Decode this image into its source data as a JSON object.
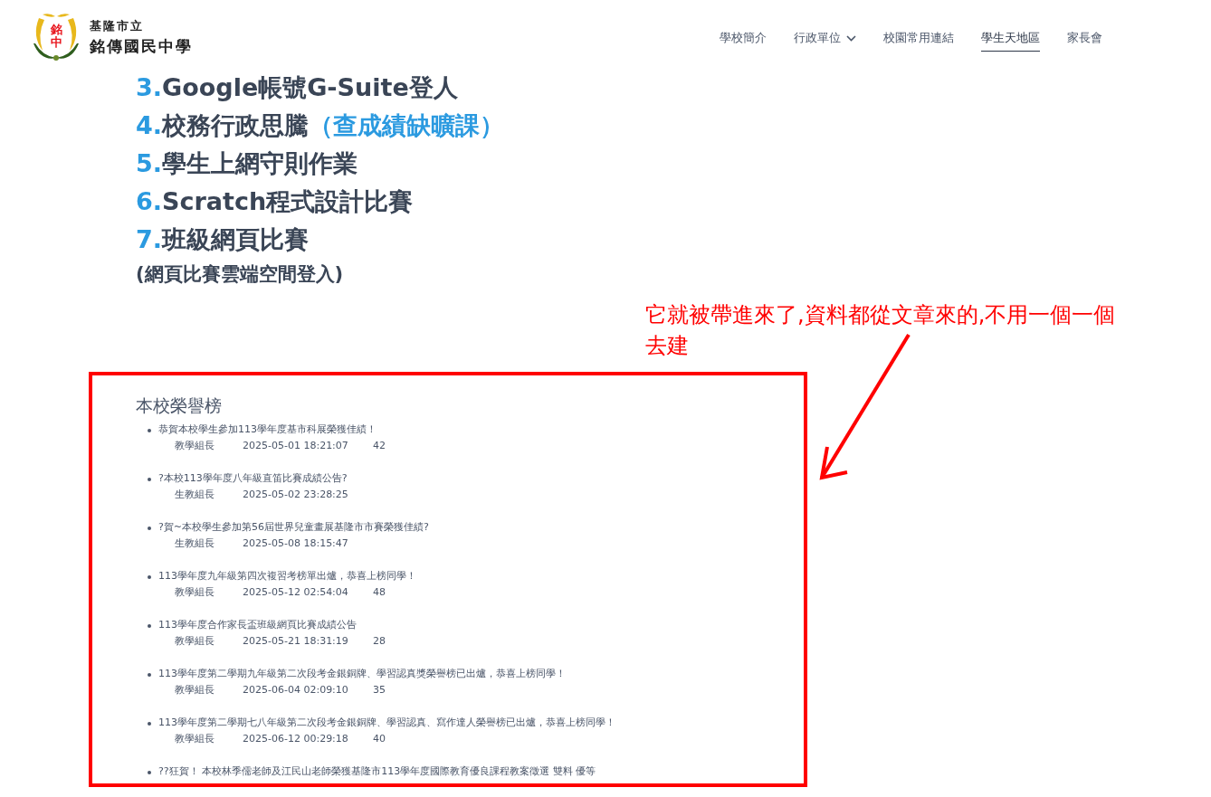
{
  "header": {
    "logo": {
      "mark_text": "銘中",
      "city": "基隆市立",
      "school": "銘傳國民中學"
    },
    "nav": [
      {
        "label": "學校簡介",
        "selected": false,
        "has_dropdown": false
      },
      {
        "label": "行政單位",
        "selected": false,
        "has_dropdown": true
      },
      {
        "label": "校園常用連結",
        "selected": false,
        "has_dropdown": false
      },
      {
        "label": "學生天地區",
        "selected": true,
        "has_dropdown": false
      },
      {
        "label": "家長會",
        "selected": false,
        "has_dropdown": false
      }
    ]
  },
  "link_list": [
    {
      "number": "3.",
      "text": "Google帳號G-Suite登人"
    },
    {
      "number": "4.",
      "text": "校務行政思騰",
      "link": "（查成績缺曠課）"
    },
    {
      "number": "5.",
      "text": "學生上網守則作業"
    },
    {
      "number": "6.",
      "text": "Scratch程式設計比賽"
    },
    {
      "number": "7.",
      "text": "班級網頁比賽"
    }
  ],
  "link_note": "(網頁比賽雲端空間登入)",
  "annotation": {
    "text": "它就被帶進來了,資料都從文章來的,不用一個一個去建"
  },
  "honor_roll": {
    "title": "本校榮譽榜",
    "items": [
      {
        "title": "恭賀本校學生參加113學年度基市科展榮獲佳績！",
        "author": "教學組長",
        "date": "2025-05-01 18:21:07",
        "count": "42"
      },
      {
        "title": "?本校113學年度八年級直笛比賽成績公告?",
        "author": "生教組長",
        "date": "2025-05-02 23:28:25"
      },
      {
        "title": "?賀~本校學生參加第56屆世界兒童畫展基隆市市賽榮獲佳績?",
        "author": "生教組長",
        "date": "2025-05-08 18:15:47"
      },
      {
        "title": "113學年度九年級第四次複習考榜單出爐，恭喜上榜同學！",
        "author": "教學組長",
        "date": "2025-05-12 02:54:04",
        "count": "48"
      },
      {
        "title": "113學年度合作家長盃班級網頁比賽成績公告",
        "author": "教學組長",
        "date": "2025-05-21 18:31:19",
        "count": "28"
      },
      {
        "title": "113學年度第二學期九年級第二次段考金銀銅牌、學習認真獎榮譽榜已出爐，恭喜上榜同學！",
        "author": "教學組長",
        "date": "2025-06-04 02:09:10",
        "count": "35"
      },
      {
        "title": "113學年度第二學期七八年級第二次段考金銀銅牌、學習認真、寫作達人榮譽榜已出爐，恭喜上榜同學！",
        "author": "教學組長",
        "date": "2025-06-12 00:29:18",
        "count": "40"
      },
      {
        "title": "??狂賀！ 本校林季儒老師及江民山老師榮獲基隆市113學年度國際教育優良課程教案徵選 雙料 優等"
      }
    ]
  }
}
